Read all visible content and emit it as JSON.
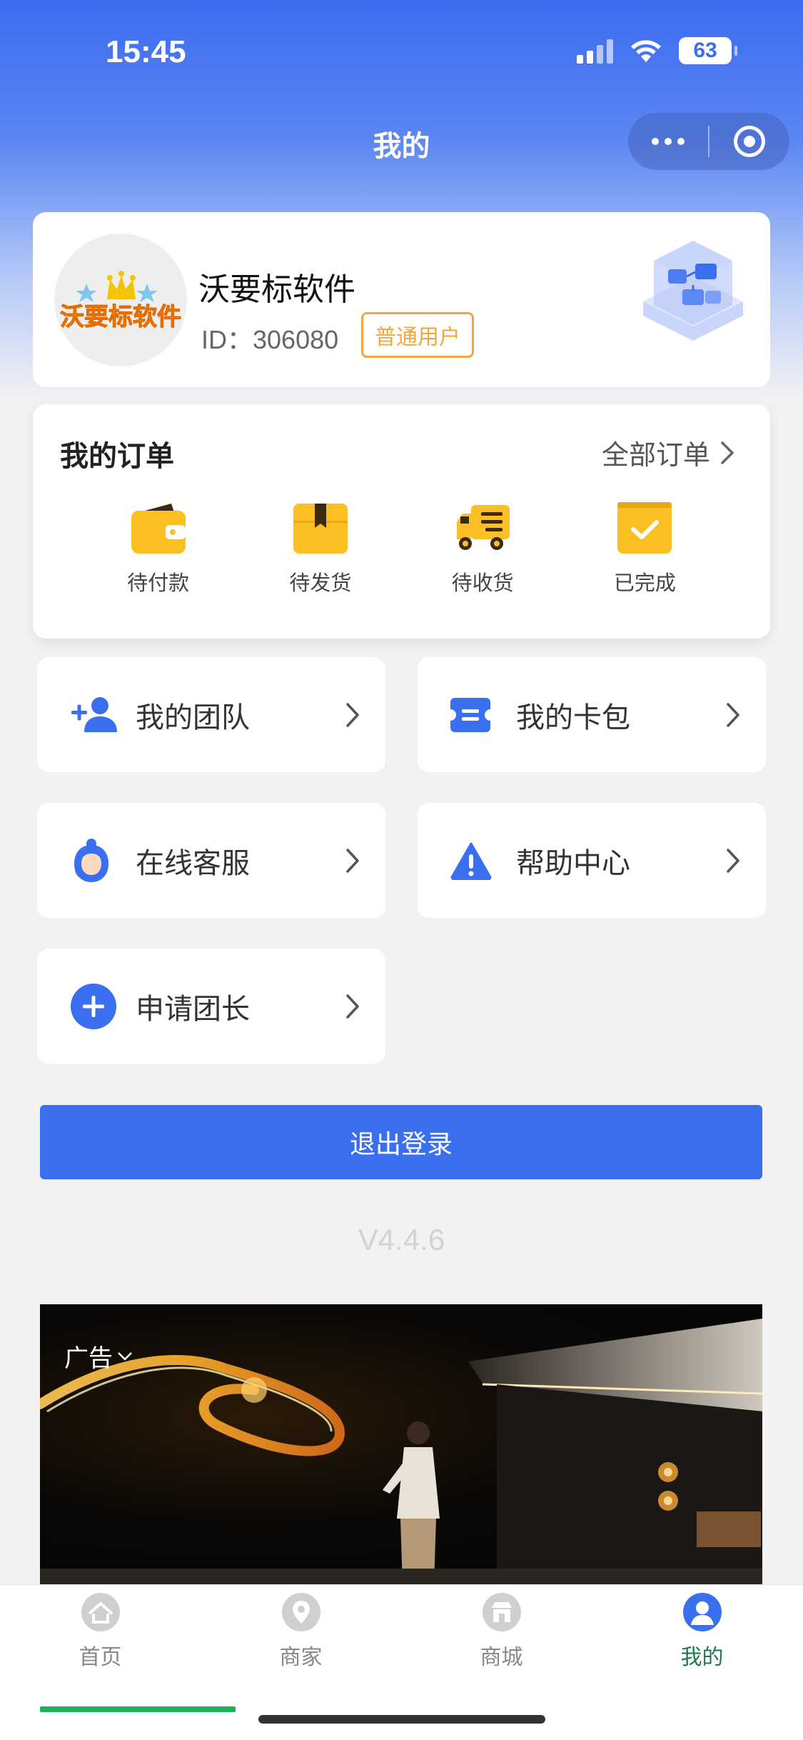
{
  "status": {
    "time": "15:45",
    "battery": "63"
  },
  "nav": {
    "title": "我的"
  },
  "profile": {
    "name": "沃要标软件",
    "id_text": "ID：306080",
    "badge": "普通用户",
    "avatar_text": "沃要标软件"
  },
  "orders": {
    "title": "我的订单",
    "all_label": "全部订单",
    "items": [
      {
        "label": "待付款",
        "icon": "wallet-icon"
      },
      {
        "label": "待发货",
        "icon": "package-icon"
      },
      {
        "label": "待收货",
        "icon": "truck-icon"
      },
      {
        "label": "已完成",
        "icon": "completed-icon"
      }
    ]
  },
  "menu": {
    "team": "我的团队",
    "cards": "我的卡包",
    "service": "在线客服",
    "help": "帮助中心",
    "apply": "申请团长"
  },
  "logout_label": "退出登录",
  "version": "V4.4.6",
  "ad": {
    "label": "广告"
  },
  "tabs": [
    {
      "label": "首页",
      "icon": "home-icon"
    },
    {
      "label": "商家",
      "icon": "location-icon"
    },
    {
      "label": "商城",
      "icon": "store-icon"
    },
    {
      "label": "我的",
      "icon": "user-icon"
    }
  ],
  "colors": {
    "primary": "#3a6ff0",
    "accent_orange": "#f0a83a",
    "icon_yellow": "#fbbf24",
    "tab_active": "#1f7a4e"
  }
}
